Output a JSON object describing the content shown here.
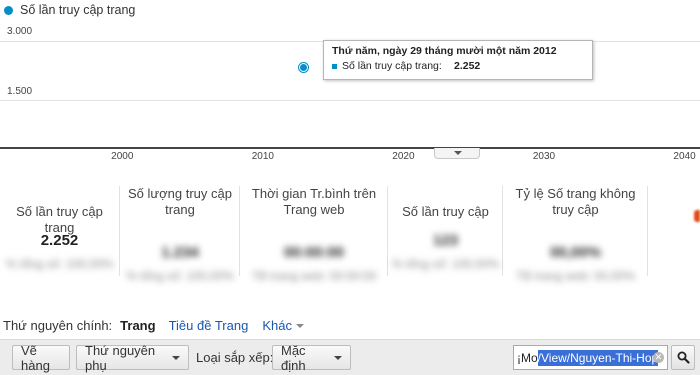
{
  "legend": {
    "series_label": "Số lần truy cập trang",
    "series_color": "#058dc7"
  },
  "chart_data": {
    "type": "scatter",
    "series": [
      {
        "name": "Số lần truy cập trang",
        "points": [
          {
            "x": 2012.9,
            "y": 2252
          }
        ]
      }
    ],
    "yticks": [
      "3.000",
      "1.500"
    ],
    "xticks": [
      "2000",
      "2010",
      "2020",
      "2030",
      "2040"
    ],
    "ylim": [
      0,
      3000
    ],
    "xlim": [
      1991.3,
      2041.1
    ],
    "grid": true
  },
  "tooltip": {
    "title": "Thứ năm, ngày 29 tháng mười một năm 2012",
    "metric_label": "Số lần truy cập trang:",
    "metric_value": "2.252"
  },
  "metrics": [
    {
      "label": "Số lần truy cập trang",
      "value": "2.252",
      "sub": "% tổng số: 100,00%"
    },
    {
      "label": "Số lượng truy cập trang",
      "value": "1.234",
      "sub": "% tổng số: 100,00%"
    },
    {
      "label": "Thời gian Tr.bình trên Trang web",
      "value": "00:00:00",
      "sub": "TB trang web: 00:00:00"
    },
    {
      "label": "Số lần truy cập",
      "value": "123",
      "sub": "% tổng số: 100,00%"
    },
    {
      "label": "Tỷ lệ Số trang không truy cập",
      "value": "00,00%",
      "sub": "TB trang web: 00,00%"
    }
  ],
  "dimensions": {
    "label": "Thứ nguyên chính:",
    "active": "Trang",
    "alt": "Tiêu đề Trang",
    "more": "Khác"
  },
  "toolbar": {
    "plot_rows": "Vẽ hàng",
    "secondary_dimension": "Thứ nguyên phụ",
    "sort_label": "Loại sắp xếp:",
    "sort_value": "Mặc định",
    "search_prefix": "¡Mo",
    "search_selected": "/View/Nguyen-Thi-Hop"
  }
}
